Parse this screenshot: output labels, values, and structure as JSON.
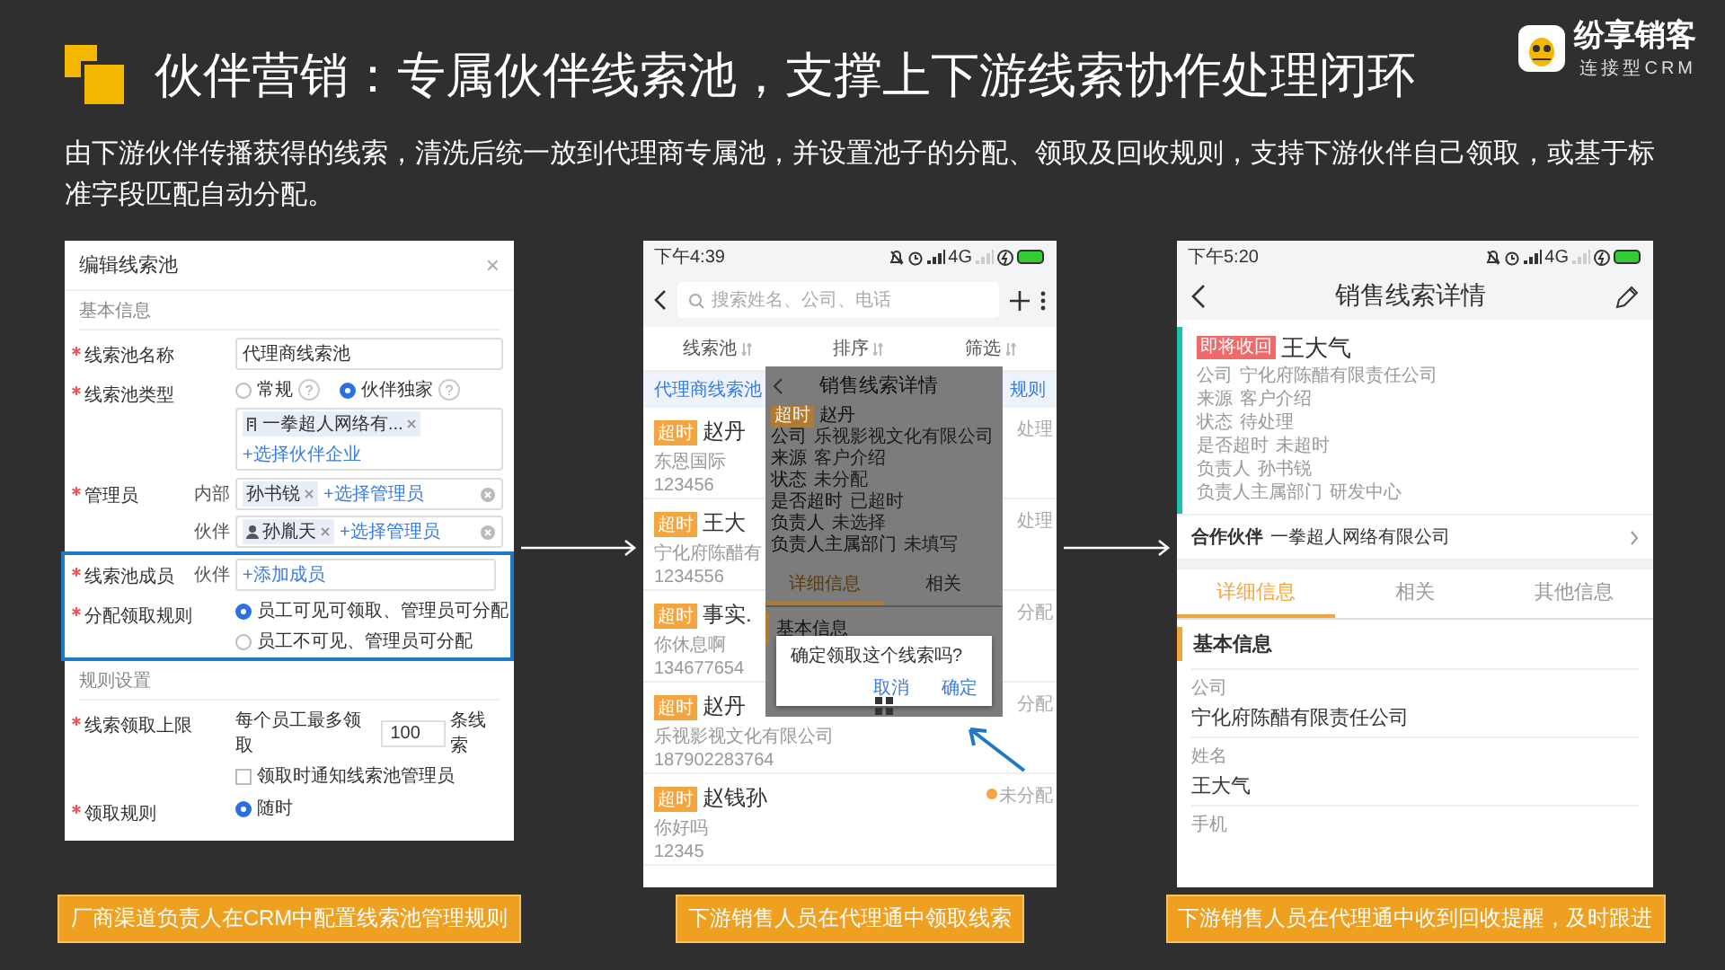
{
  "slide": {
    "title": "伙伴营销：专属伙伴线索池，支撑上下游线索协作处理闭环",
    "description": "由下游伙伴传播获得的线索，清洗后统一放到代理商专属池，并设置池子的分配、领取及回收规则，支持下游伙伴自己领取，或基于标准字段匹配自动分配。"
  },
  "logo": {
    "name": "纷享销客",
    "tagline": "连接型CRM"
  },
  "pool_editor": {
    "title": "编辑线索池",
    "close": "×",
    "sections": [
      {
        "heading": "基本信息",
        "rows": [
          {
            "kind": "row",
            "label": "线索池名称",
            "required": true,
            "lines": [
              {
                "kind": "input",
                "value": "代理商线索池"
              }
            ]
          },
          {
            "kind": "row",
            "label": "线索池类型",
            "required": true,
            "lines": [
              {
                "kind": "radio_group",
                "options": [
                  {
                    "label": "常规",
                    "selected": false,
                    "help": "?"
                  },
                  {
                    "label": "伙伴独家",
                    "selected": true,
                    "help": "?"
                  }
                ]
              },
              {
                "kind": "chip_field",
                "chips": [
                  {
                    "label": "一拳超人网络有...",
                    "kind": "company"
                  }
                ],
                "link": "+选择伙伴企业",
                "clearable": false
              }
            ]
          },
          {
            "kind": "row",
            "label": "管理员",
            "required": true,
            "lines": [
              {
                "kind": "chip_field",
                "sublabel": "内部",
                "chips": [
                  {
                    "label": "孙书锐",
                    "kind": "plain"
                  }
                ],
                "link": "+选择管理员",
                "clearable": true
              },
              {
                "kind": "chip_field",
                "sublabel": "伙伴",
                "chips": [
                  {
                    "label": "孙胤天",
                    "kind": "person"
                  }
                ],
                "link": "+选择管理员",
                "clearable": true
              }
            ]
          },
          {
            "kind": "highlight_frame",
            "rows": [
              {
                "kind": "row",
                "label": "线索池成员",
                "required": true,
                "lines": [
                  {
                    "kind": "chip_field",
                    "sublabel": "伙伴",
                    "link": "+添加成员",
                    "clearable": false
                  }
                ]
              },
              {
                "kind": "row",
                "label": "分配领取规则",
                "required": true,
                "lines": [
                  {
                    "kind": "radio",
                    "label": "员工可见可领取、管理员可分配",
                    "selected": true
                  },
                  {
                    "kind": "radio",
                    "label": "员工不可见、管理员可分配",
                    "selected": false
                  }
                ]
              }
            ]
          }
        ]
      },
      {
        "heading": "规则设置",
        "rows": [
          {
            "kind": "row",
            "label": "线索领取上限",
            "required": true,
            "lines": [
              {
                "kind": "limit",
                "prefix": "每个员工最多领取",
                "value": "100",
                "suffix": "条线索"
              },
              {
                "kind": "checkbox",
                "label": "领取时通知线索池管理员",
                "checked": false
              }
            ]
          },
          {
            "kind": "row",
            "label": "领取规则",
            "required": true,
            "lines": [
              {
                "kind": "radio",
                "label": "随时",
                "selected": true
              }
            ]
          }
        ]
      }
    ]
  },
  "claim_screen": {
    "status": {
      "time": "下午4:39",
      "network": "4G"
    },
    "search_placeholder": "搜索姓名、公司、电话",
    "filters": [
      {
        "label": "线索池"
      },
      {
        "label": "排序"
      },
      {
        "label": "筛选"
      }
    ],
    "banner": {
      "left": "代理商线索池",
      "right": "规则"
    },
    "leads": [
      {
        "badge": "超时",
        "name": "赵丹",
        "company": "东恩国际",
        "phone": "123456",
        "status": "处理",
        "status_dot": false
      },
      {
        "badge": "超时",
        "name": "王大",
        "company": "宁化府陈醋有",
        "phone": "1234556",
        "status": "处理",
        "status_dot": false
      },
      {
        "badge": "超时",
        "name": "事实.",
        "company": "你休息啊",
        "phone": "134677654",
        "status": "分配",
        "status_dot": false
      },
      {
        "badge": "超时",
        "name": "赵丹",
        "company": "乐视影视文化有限公司",
        "phone": "187902283764",
        "status": "分配",
        "status_dot": false
      },
      {
        "badge": "超时",
        "name": "赵钱孙",
        "company": "你好吗",
        "phone": "12345",
        "status": "未分配",
        "status_dot": true
      }
    ],
    "overlay": {
      "title": "销售线索详情",
      "badge": "超时",
      "name": "赵丹",
      "fields": [
        {
          "label": "公司",
          "value": "乐视影视文化有限公司"
        },
        {
          "label": "来源",
          "value": "客户介绍"
        },
        {
          "label": "状态",
          "value": "未分配"
        },
        {
          "label": "是否超时",
          "value": "已超时"
        },
        {
          "label": "负责人",
          "value": "未选择"
        },
        {
          "label": "负责人主属部门",
          "value": "未填写"
        }
      ],
      "tabs": [
        {
          "label": "详细信息",
          "selected": true
        },
        {
          "label": "相关",
          "selected": false
        }
      ],
      "section": "基本信息",
      "dialog": {
        "message": "确定领取这个线索吗?",
        "buttons": [
          "取消",
          "确定"
        ]
      }
    }
  },
  "detail_screen": {
    "status": {
      "time": "下午5:20",
      "network": "4G"
    },
    "title": "销售线索详情",
    "badge": "即将收回",
    "name": "王大气",
    "fields": [
      {
        "label": "公司",
        "value": "宁化府陈醋有限责任公司"
      },
      {
        "label": "来源",
        "value": "客户介绍"
      },
      {
        "label": "状态",
        "value": "待处理"
      },
      {
        "label": "是否超时",
        "value": "未超时"
      },
      {
        "label": "负责人",
        "value": "孙书锐"
      },
      {
        "label": "负责人主属部门",
        "value": "研发中心"
      }
    ],
    "partner": {
      "label": "合作伙伴",
      "value": "一拳超人网络有限公司"
    },
    "tabs": [
      {
        "label": "详细信息",
        "selected": true
      },
      {
        "label": "相关",
        "selected": false
      },
      {
        "label": "其他信息",
        "selected": false
      }
    ],
    "section": "基本信息",
    "details": [
      {
        "label": "公司",
        "value": "宁化府陈醋有限责任公司"
      },
      {
        "label": "姓名",
        "value": "王大气"
      },
      {
        "label": "手机"
      }
    ]
  },
  "captions": [
    "厂商渠道负责人在CRM中配置线索池管理规则",
    "下游销售人员在代理通中领取线索",
    "下游销售人员在代理通中收到回收提醒，及时跟进"
  ]
}
